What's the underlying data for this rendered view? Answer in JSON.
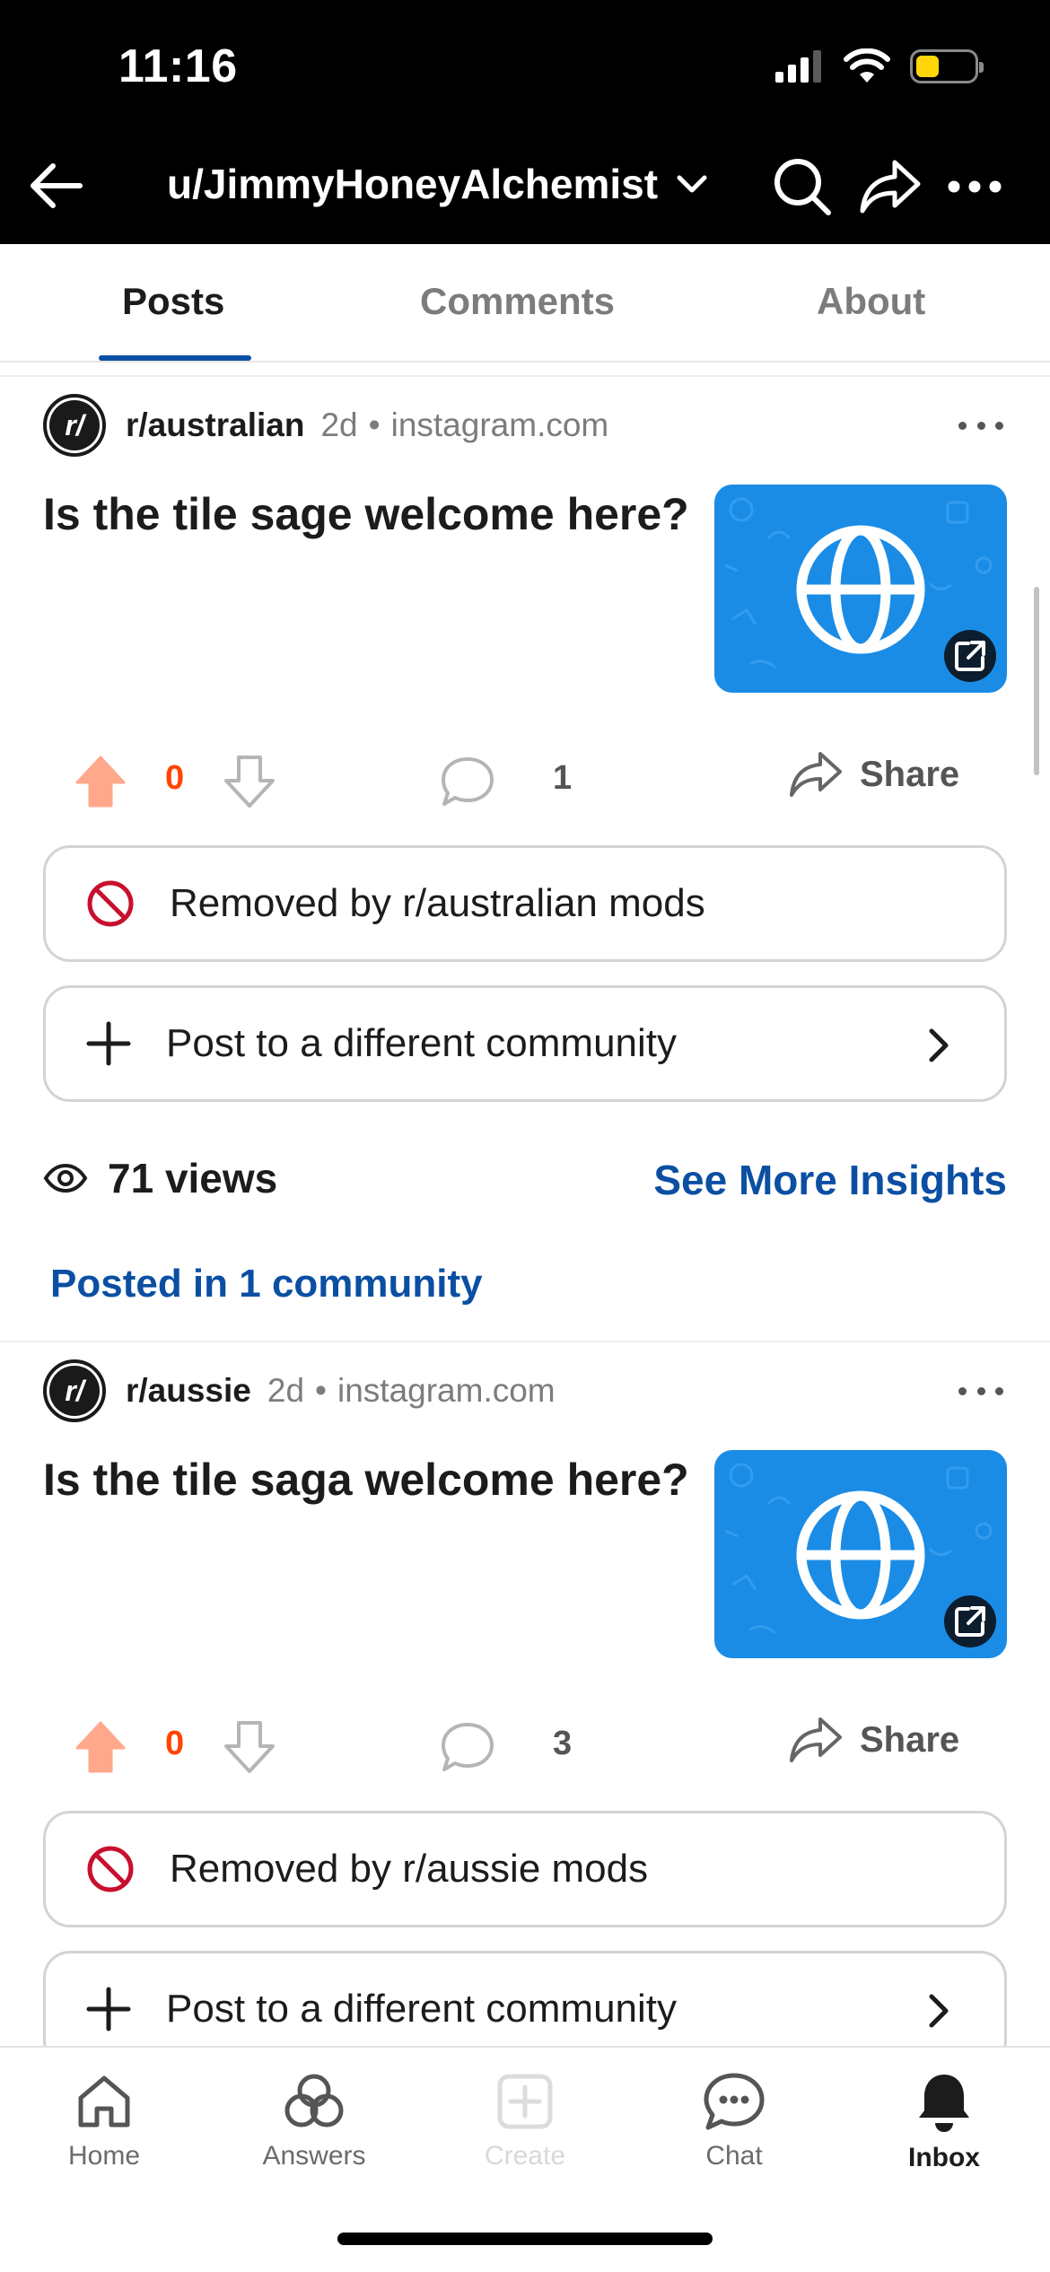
{
  "status_bar": {
    "time": "11:16"
  },
  "app_bar": {
    "title": "u/JimmyHoneyAlchemist"
  },
  "tabs": [
    {
      "label": "Posts",
      "active": true
    },
    {
      "label": "Comments",
      "active": false
    },
    {
      "label": "About",
      "active": false
    }
  ],
  "posts": [
    {
      "subreddit": "r/australian",
      "age": "2d",
      "domain": "instagram.com",
      "title": "Is the tile sage welcome here?",
      "score": "0",
      "comments": "1",
      "share_label": "Share",
      "removed_text": "Removed by r/australian mods",
      "repost_text": "Post to a different community",
      "views": "71 views",
      "insights_label": "See More Insights",
      "posted_in": "Posted in 1 community"
    },
    {
      "subreddit": "r/aussie",
      "age": "2d",
      "domain": "instagram.com",
      "title": "Is the tile saga welcome here?",
      "score": "0",
      "comments": "3",
      "share_label": "Share",
      "removed_text": "Removed by r/aussie mods",
      "repost_text": "Post to a different community"
    }
  ],
  "bottom_nav": [
    {
      "label": "Home",
      "icon": "home-icon"
    },
    {
      "label": "Answers",
      "icon": "answers-icon"
    },
    {
      "label": "Create",
      "icon": "create-icon",
      "disabled": true
    },
    {
      "label": "Chat",
      "icon": "chat-icon"
    },
    {
      "label": "Inbox",
      "icon": "bell-icon",
      "active": true
    }
  ],
  "colors": {
    "upvote": "#ff4500",
    "link": "#0b4fa3",
    "removed": "#c8102e",
    "thumbnail": "#1a8ce6",
    "battery": "#ffd60a"
  }
}
